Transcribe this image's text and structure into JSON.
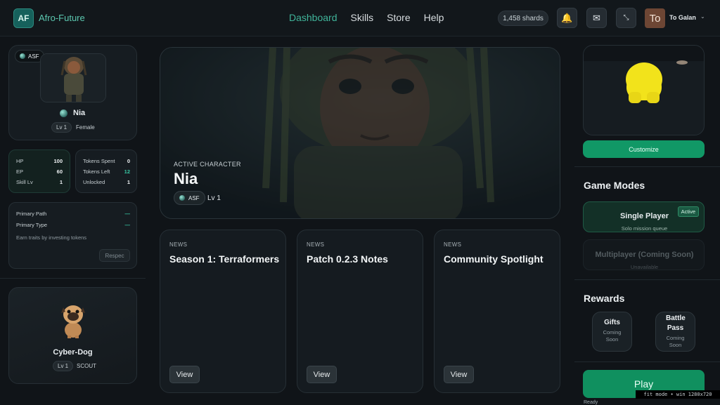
{
  "header": {
    "logo_text": "AF",
    "brand": "Afro-Future",
    "nav": [
      "Dashboard",
      "Skills",
      "Store",
      "Help"
    ],
    "active_nav": "Dashboard",
    "shards": "1,458 shards",
    "avatar_text": "To",
    "username": "To Galan",
    "icons": [
      "bell-icon",
      "mail-icon",
      "fullscreen-icon",
      "chevron-down-icon"
    ]
  },
  "character_card": {
    "badge": "ASF",
    "name": "Nia",
    "level": "Lv 1",
    "gender": "Female"
  },
  "stats": {
    "left": [
      {
        "label": "HP",
        "value": "100"
      },
      {
        "label": "EP",
        "value": "60"
      },
      {
        "label": "Skill Lv",
        "value": "1"
      }
    ],
    "right": [
      {
        "label": "Tokens Spent",
        "value": "0"
      },
      {
        "label": "Tokens Left",
        "value": "12"
      },
      {
        "label": "Unlocked",
        "value": "1"
      }
    ]
  },
  "path": {
    "primary_path_label": "Primary Path",
    "primary_path_value": "—",
    "primary_type_label": "Primary Type",
    "primary_type_value": "—",
    "hint": "Earn traits by investing tokens",
    "respec": "Respec"
  },
  "pet": {
    "name": "Cyber-Dog",
    "level": "Lv 1",
    "role": "SCOUT"
  },
  "hero": {
    "kicker": "ACTIVE CHARACTER",
    "name": "Nia",
    "badge": "ASF",
    "level": "Lv 1"
  },
  "news": [
    {
      "kicker": "NEWS",
      "title": "Season 1: Terraformers",
      "button": "View"
    },
    {
      "kicker": "NEWS",
      "title": "Patch 0.2.3 Notes",
      "button": "View"
    },
    {
      "kicker": "NEWS",
      "title": "Community Spotlight",
      "button": "View"
    }
  ],
  "right_panel": {
    "customize": "Customize",
    "game_modes_title": "Game Modes",
    "single_player": {
      "title": "Single Player",
      "badge": "Active",
      "sub": "Solo mission queue"
    },
    "multiplayer": {
      "title": "Multiplayer (Coming Soon)",
      "sub": "Unavailable"
    },
    "rewards_title": "Rewards",
    "gifts": {
      "title": "Gifts",
      "sub": "Coming Soon"
    },
    "battle_pass": {
      "title": "Battle Pass",
      "sub": "Coming Soon"
    },
    "play": "Play",
    "status": "Ready"
  },
  "overlay": {
    "fit_mode": "fit mode • win 1280x720"
  },
  "colors": {
    "accent": "#119866",
    "teal_text": "#40b49a",
    "background": "#101418"
  }
}
